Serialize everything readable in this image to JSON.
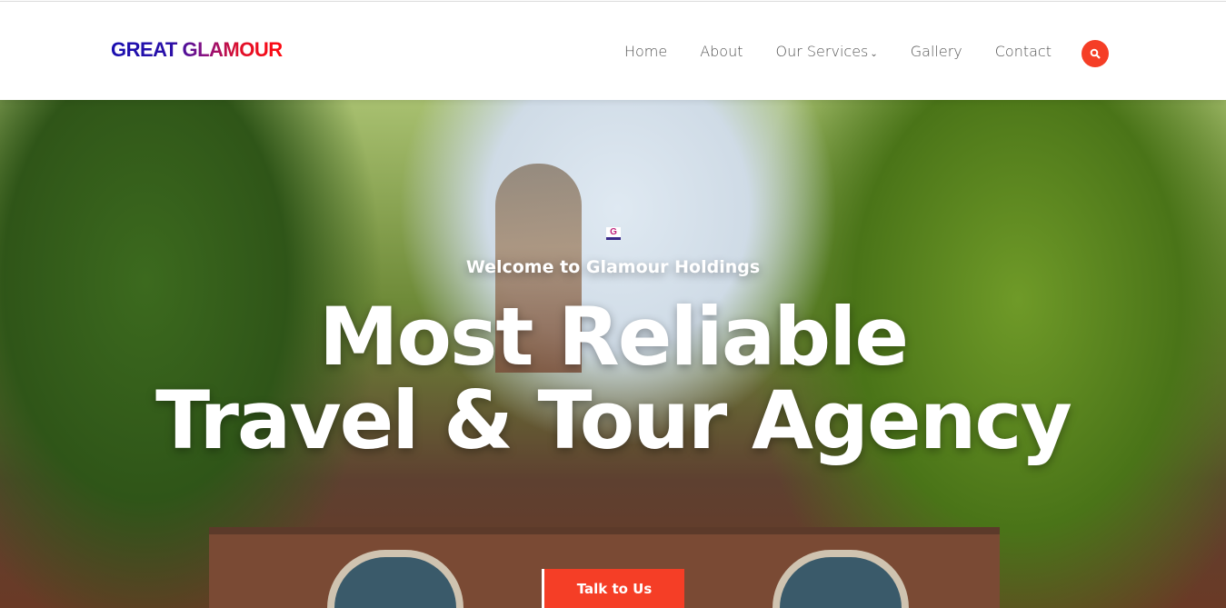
{
  "header": {
    "logo": "GREAT GLAMOUR",
    "nav": [
      {
        "label": "Home"
      },
      {
        "label": "About"
      },
      {
        "label": "Our Services",
        "dropdown": true
      },
      {
        "label": "Gallery"
      },
      {
        "label": "Contact"
      }
    ],
    "search_icon": "search-icon",
    "accent": "#f53e26"
  },
  "hero": {
    "subtitle": "Welcome to Glamour Holdings",
    "title_line1": "Most Reliable",
    "title_line2": "Travel & Tour Agency",
    "badge": "G",
    "cta": "Talk to Us"
  }
}
